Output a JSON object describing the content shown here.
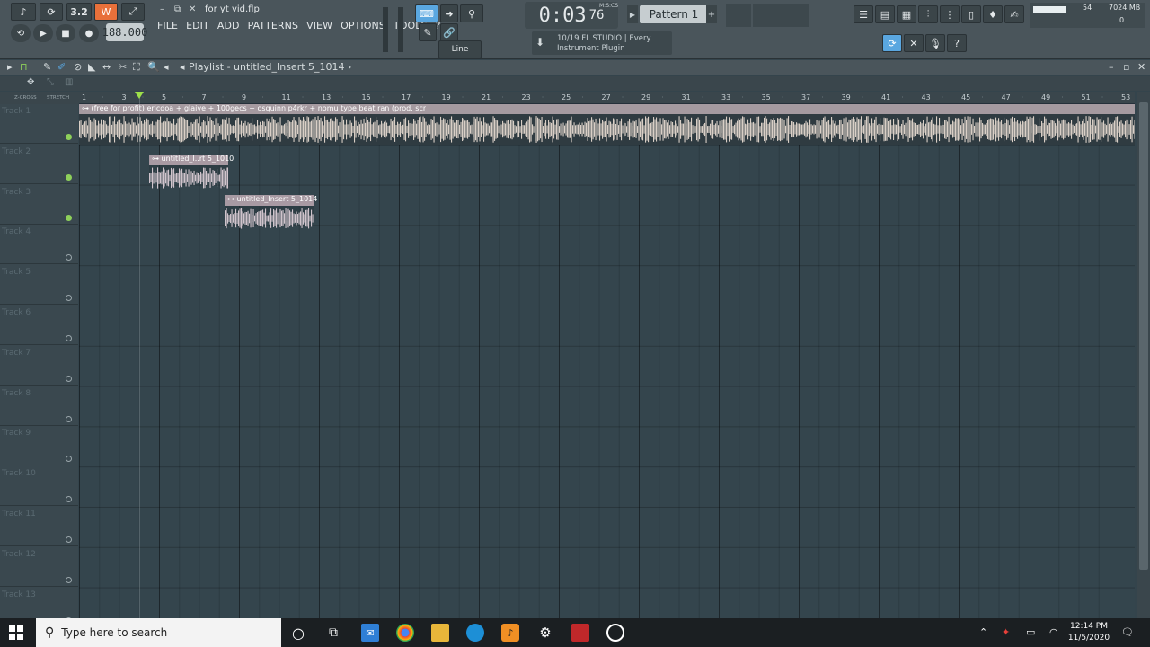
{
  "window": {
    "filename": "for yt vid.flp"
  },
  "menu": [
    "FILE",
    "EDIT",
    "ADD",
    "PATTERNS",
    "VIEW",
    "OPTIONS",
    "TOOLS",
    "?"
  ],
  "toolbar": {
    "tempo": "188.000",
    "time": "0:03",
    "time_frac": "76",
    "time_unit": "M:S:CS",
    "pattern": "Pattern 1",
    "snap": "Line",
    "hint_line1": "10/19  FL STUDIO | Every",
    "hint_line2": "Instrument Plugin",
    "cpu": "54",
    "memory": "7024 MB",
    "polyphony": "0",
    "mode_buttons": [
      "3.2"
    ]
  },
  "playlist": {
    "title": "Playlist - untitled_Insert 5_1014",
    "left_labels": [
      "Z-CROSS",
      "STRETCH"
    ],
    "ruler": [
      "1",
      "",
      "3",
      "",
      "5",
      "",
      "7",
      "",
      "9",
      "",
      "11",
      "",
      "13",
      "",
      "15",
      "",
      "17",
      "",
      "19",
      "",
      "21",
      "",
      "23",
      "",
      "25",
      "",
      "27",
      "",
      "29",
      "",
      "31",
      "",
      "33",
      "",
      "35",
      "",
      "37",
      "",
      "39",
      "",
      "41",
      "",
      "43",
      "",
      "45",
      "",
      "47",
      "",
      "49",
      "",
      "51",
      "",
      "53"
    ],
    "tracks": [
      {
        "name": "Track 1",
        "active": true
      },
      {
        "name": "Track 2",
        "active": true
      },
      {
        "name": "Track 3",
        "active": true
      },
      {
        "name": "Track 4",
        "active": false
      },
      {
        "name": "Track 5",
        "active": false
      },
      {
        "name": "Track 6",
        "active": false
      },
      {
        "name": "Track 7",
        "active": false
      },
      {
        "name": "Track 8",
        "active": false
      },
      {
        "name": "Track 9",
        "active": false
      },
      {
        "name": "Track 10",
        "active": false
      },
      {
        "name": "Track 11",
        "active": false
      },
      {
        "name": "Track 12",
        "active": false
      },
      {
        "name": "Track 13",
        "active": false
      }
    ],
    "clips": {
      "main": "(free for profit) ericdoa + glaive + 100gecs + osquinn p4rkr + nomu type beat ran (prod. scr",
      "clip2": "untitled_I..rt 5_1010",
      "clip3": "untitled_Insert 5_1014"
    }
  },
  "taskbar": {
    "search_placeholder": "Type here to search",
    "time": "12:14 PM",
    "date": "11/5/2020",
    "notifications": "1"
  }
}
